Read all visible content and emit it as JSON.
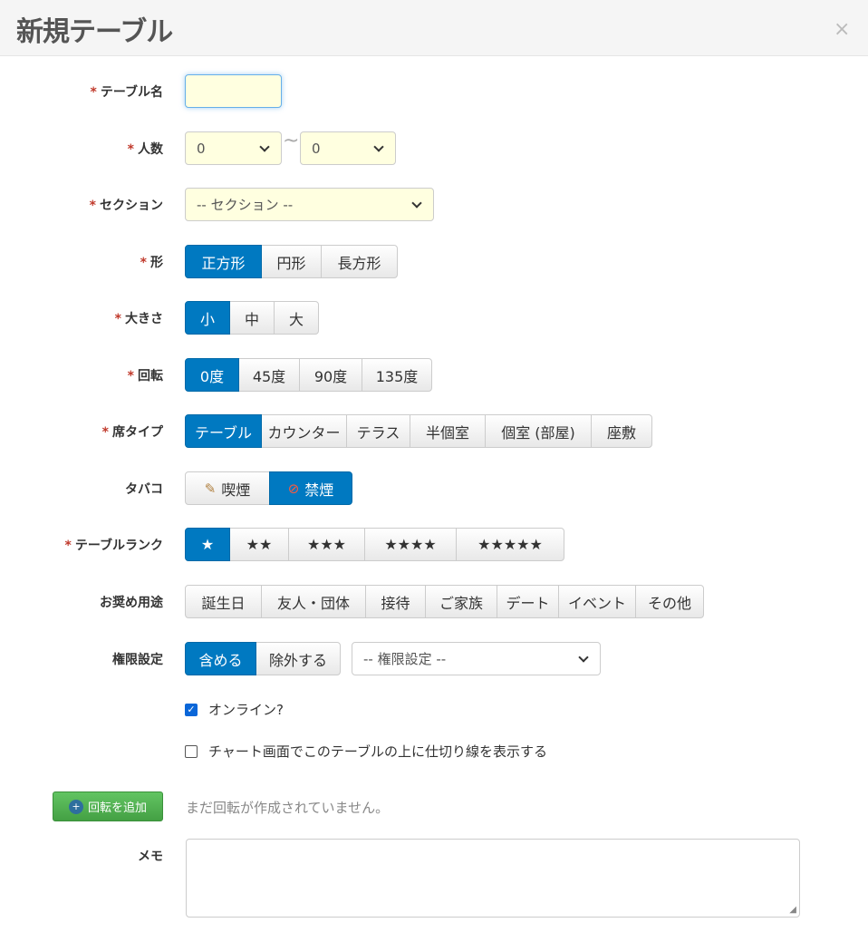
{
  "header": {
    "title": "新規テーブル",
    "close": "×"
  },
  "required_mark": "*",
  "fields": {
    "name": {
      "label": "テーブル名",
      "value": ""
    },
    "people": {
      "label": "人数",
      "min": "0",
      "tilde": "~",
      "max": "0"
    },
    "section": {
      "label": "セクション",
      "value": "-- セクション --"
    },
    "shape": {
      "label": "形",
      "options": [
        "正方形",
        "円形",
        "長方形"
      ],
      "selected": "正方形"
    },
    "size": {
      "label": "大きさ",
      "options": [
        "小",
        "中",
        "大"
      ],
      "selected": "小"
    },
    "rotation": {
      "label": "回転",
      "options": [
        "0度",
        "45度",
        "90度",
        "135度"
      ],
      "selected": "0度"
    },
    "seat_type": {
      "label": "席タイプ",
      "options": [
        "テーブル",
        "カウンター",
        "テラス",
        "半個室",
        "個室 (部屋)",
        "座敷"
      ],
      "selected": "テーブル"
    },
    "tobacco": {
      "label": "タバコ",
      "options": [
        "喫煙",
        "禁煙"
      ],
      "selected": "禁煙"
    },
    "rank": {
      "label": "テーブルランク",
      "options": [
        "★",
        "★★",
        "★★★",
        "★★★★",
        "★★★★★"
      ],
      "selected": "★"
    },
    "usage": {
      "label": "お奨め用途",
      "options": [
        "誕生日",
        "友人・団体",
        "接待",
        "ご家族",
        "デート",
        "イベント",
        "その他"
      ]
    },
    "permission": {
      "label": "権限設定",
      "options": [
        "含める",
        "除外する"
      ],
      "selected": "含める",
      "select_value": "-- 権限設定 --"
    }
  },
  "checkboxes": [
    {
      "label": "オンライン?",
      "checked": true
    },
    {
      "label": "チャート画面でこのテーブルの上に仕切り線を表示する",
      "checked": false
    }
  ],
  "rotation_add": {
    "button": "回転を追加",
    "empty_text": "まだ回転が作成されていません。"
  },
  "memo": {
    "label": "メモ",
    "value": ""
  },
  "colors": {
    "primary": "#0079c1",
    "success": "#5cb85c",
    "required": "#c0392b",
    "input_highlight": "#ffffe0"
  }
}
